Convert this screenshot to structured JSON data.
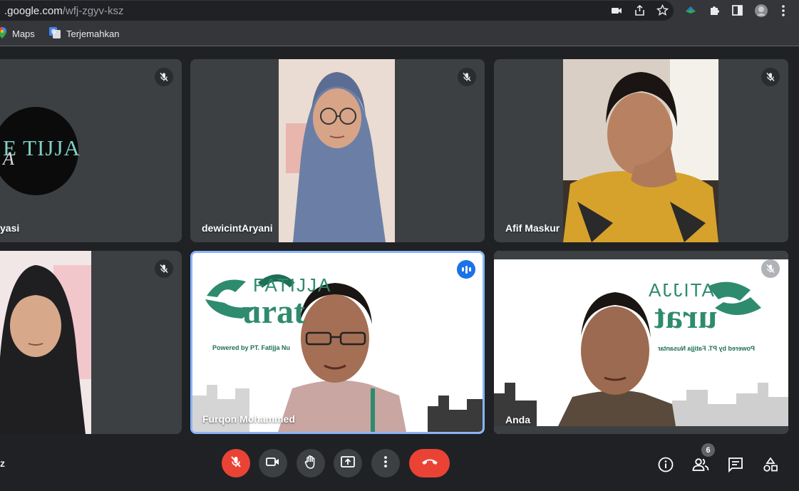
{
  "browser": {
    "url_host": ".google.com",
    "url_path": "/wfj-zgyv-ksz",
    "bookmarks": [
      {
        "label": "Maps",
        "icon": "maps-icon"
      },
      {
        "label": "Terjemahkan",
        "icon": "translate-icon"
      }
    ]
  },
  "tiles": [
    {
      "name": "yasi",
      "muted": true,
      "logo_text": "E TIJJA",
      "logo_letter": "A"
    },
    {
      "name": "dewicintAryani",
      "muted": true
    },
    {
      "name": "Afif Maskur",
      "muted": true
    },
    {
      "name": "",
      "muted": true
    },
    {
      "name": "Furqon Mohammed",
      "speaking": true,
      "banner": {
        "brand": "FATIJJA",
        "word": "urat",
        "powered": "Powered by PT. Fatijja Nu"
      }
    },
    {
      "name": "Anda",
      "muted": true,
      "banner": {
        "brand": "FATIJJA",
        "word": "urat",
        "powered": "Powered by PT. Fatijja Nusantar"
      }
    }
  ],
  "controls": {
    "left_label": "z",
    "participants_count": "6"
  },
  "colors": {
    "accent_blue": "#1a73e8",
    "leave_red": "#ea4335",
    "fatijja_green": "#2e8b6e"
  }
}
